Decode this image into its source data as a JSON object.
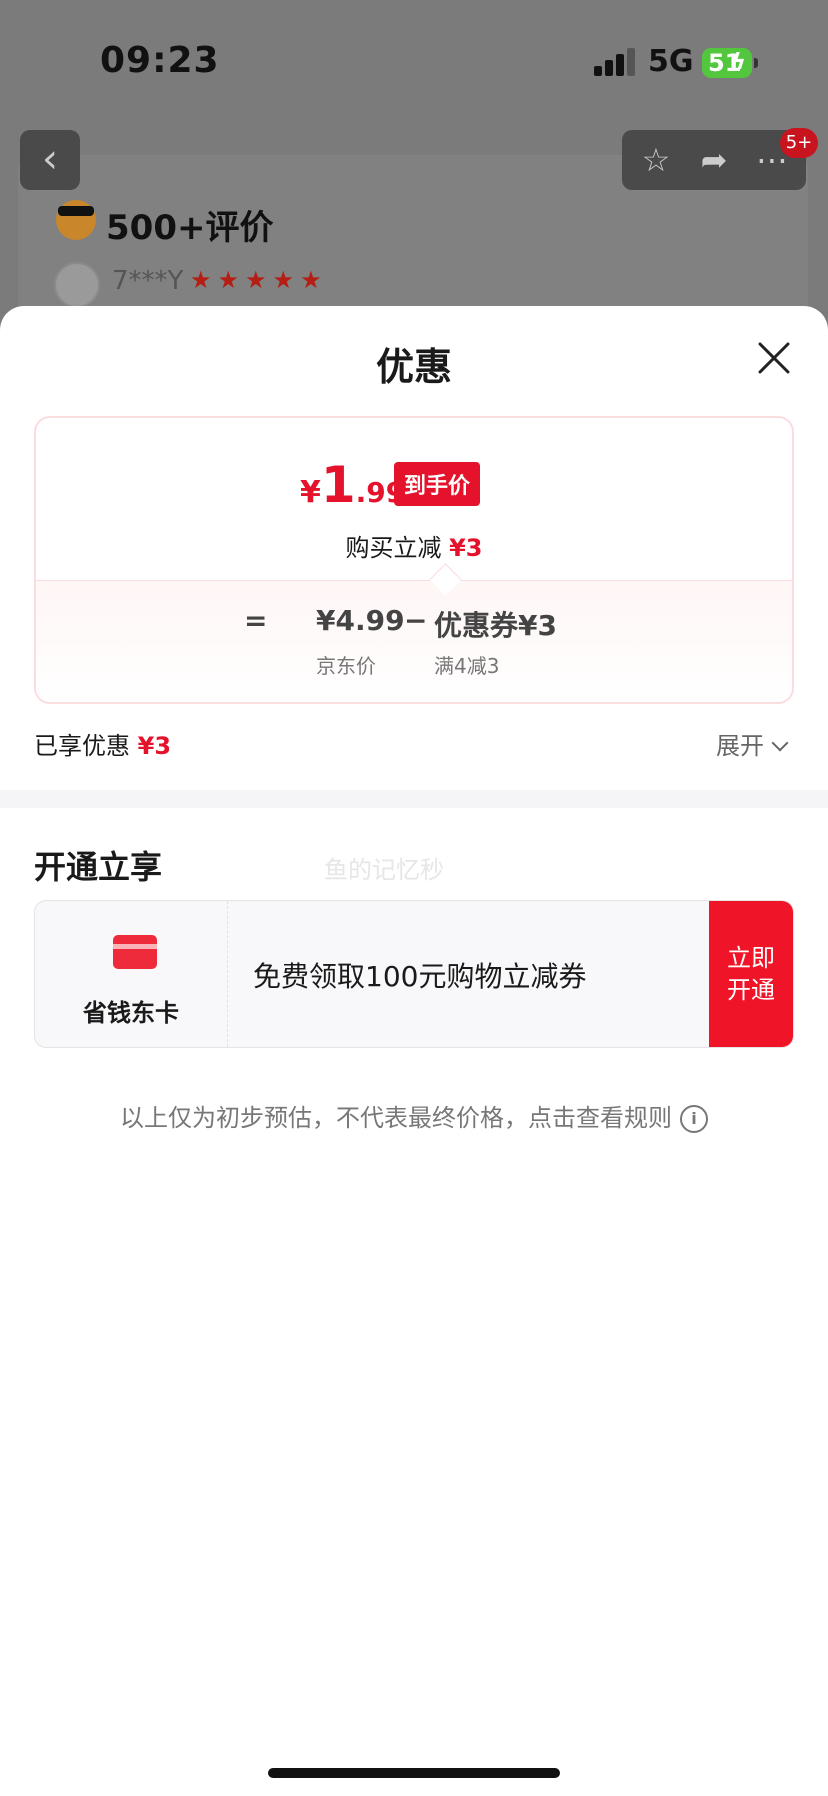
{
  "status_bar": {
    "time": "09:23",
    "network": "5G",
    "battery": "51"
  },
  "background_page": {
    "message_badge": "5+",
    "review_title": "500+评价",
    "reviewer_name": "7***Y",
    "stars": "★★★★★"
  },
  "sheet": {
    "title": "优惠",
    "price_card": {
      "currency": "¥",
      "final_int": "1",
      "final_dec": ".99",
      "final_tag": "到手价",
      "instant_label": "购买立减",
      "instant_amount": "¥3",
      "equals": "=",
      "jd_price": "¥4.99",
      "minus": "−",
      "coupon_label": "优惠券¥3",
      "jd_price_label": "京东价",
      "coupon_rule": "满4减3"
    },
    "enjoyed_label": "已享优惠",
    "enjoyed_amount": "¥3",
    "expand_label": "展开",
    "open_section_title": "开通立享",
    "watermark": "鱼的记忆秒",
    "member_card": {
      "name": "省钱东卡",
      "desc": "免费领取100元购物立减券",
      "button_line1": "立即",
      "button_line2": "开通"
    },
    "disclaimer": "以上仅为初步预估，不代表最终价格，点击查看规则",
    "info_glyph": "i"
  },
  "colors": {
    "accent_red": "#e4122b",
    "button_red": "#f01428",
    "battery_green": "#52c73e"
  }
}
